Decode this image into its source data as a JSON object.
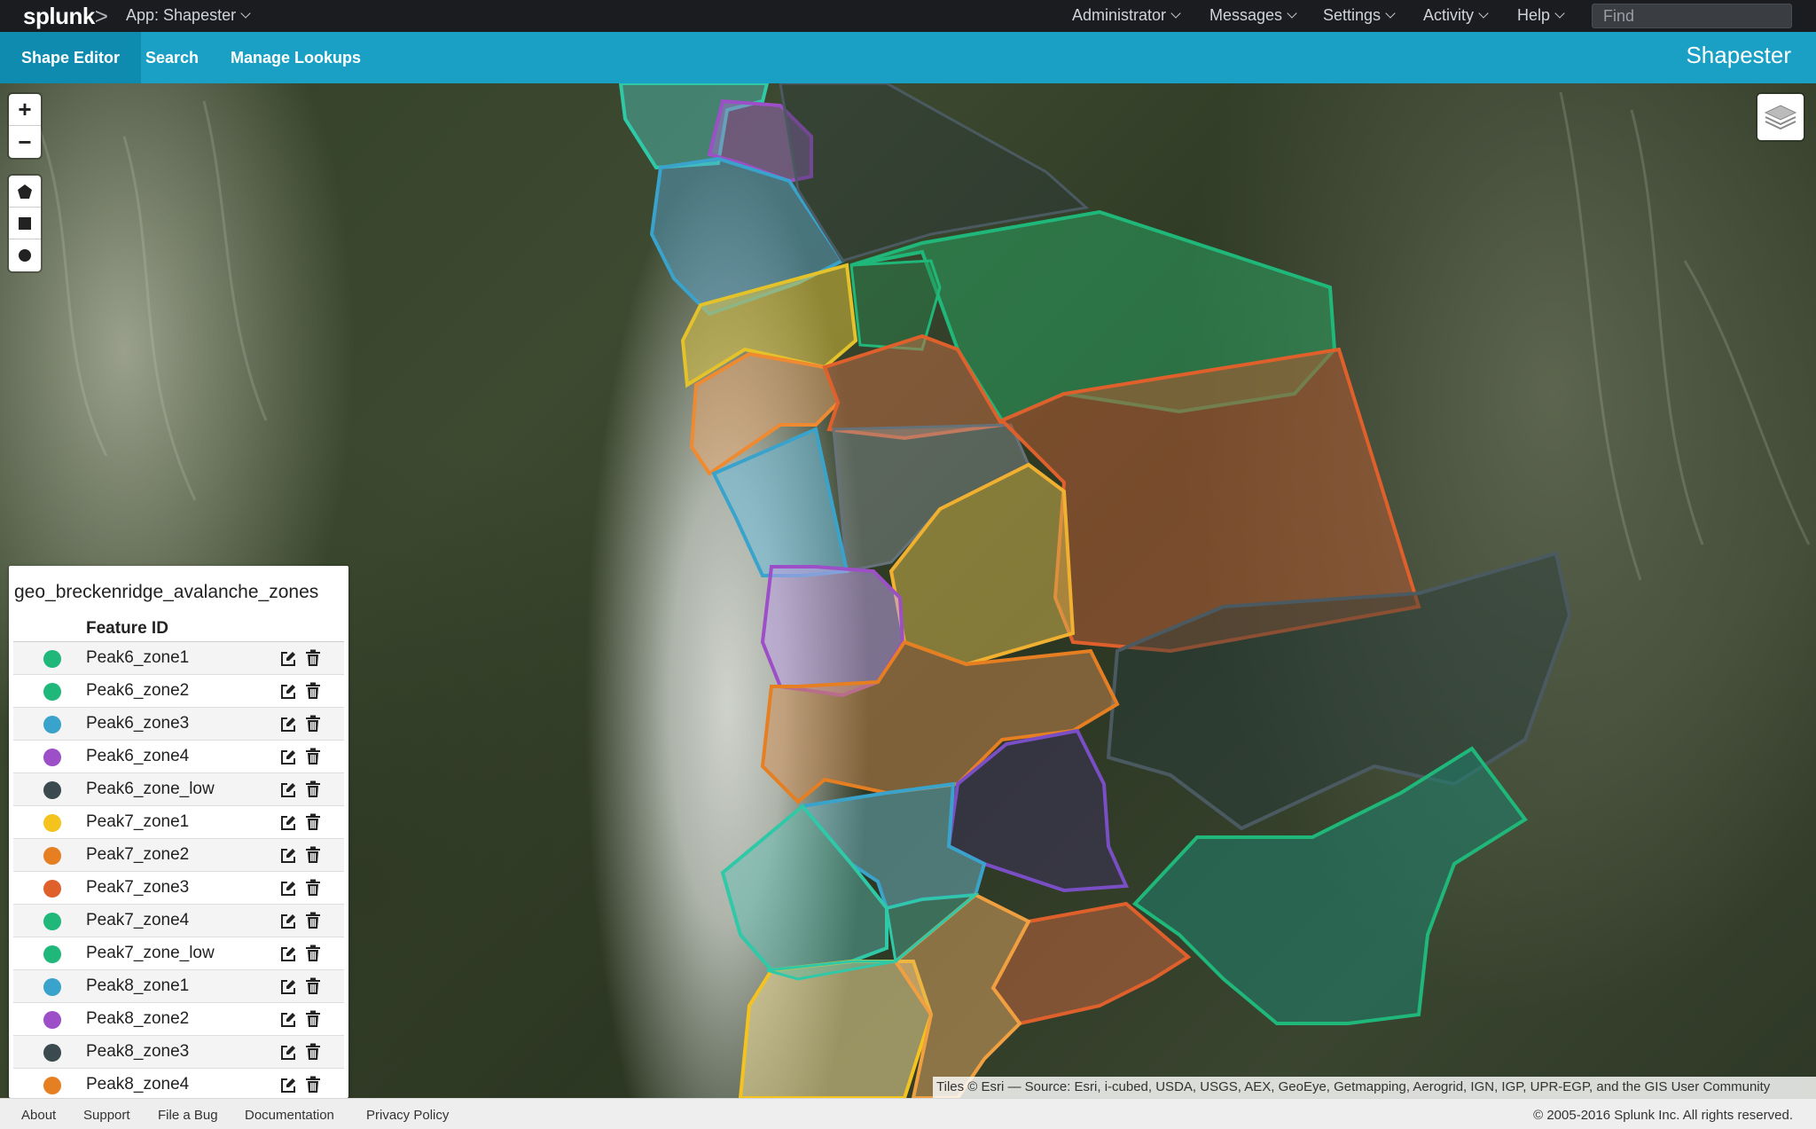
{
  "topbar": {
    "logo": "splunk",
    "logo_suffix": ">",
    "app_menu": "App: Shapester",
    "menus": [
      "Administrator",
      "Messages",
      "Settings",
      "Activity",
      "Help"
    ],
    "find_placeholder": "Find"
  },
  "navbar": {
    "items": [
      "Shape Editor",
      "Search",
      "Manage Lookups"
    ],
    "active": "Shape Editor",
    "brand": "Shapester"
  },
  "map_controls": {
    "zoom_in": "+",
    "zoom_out": "−",
    "draw_tools": [
      "polygon-tool",
      "rectangle-tool",
      "circle-tool"
    ]
  },
  "panel": {
    "title": "geo_breckenridge_avalanche_zones",
    "column_header": "Feature ID",
    "rows": [
      {
        "label": "Peak6_zone1",
        "color": "#1fb87a"
      },
      {
        "label": "Peak6_zone2",
        "color": "#1fb87a"
      },
      {
        "label": "Peak6_zone3",
        "color": "#3aa3cc"
      },
      {
        "label": "Peak6_zone4",
        "color": "#9c4fc6"
      },
      {
        "label": "Peak6_zone_low",
        "color": "#3b4a4f"
      },
      {
        "label": "Peak7_zone1",
        "color": "#f4c31d"
      },
      {
        "label": "Peak7_zone2",
        "color": "#e67e22"
      },
      {
        "label": "Peak7_zone3",
        "color": "#e0602c"
      },
      {
        "label": "Peak7_zone4",
        "color": "#1fb87a"
      },
      {
        "label": "Peak7_zone_low",
        "color": "#1fb87a"
      },
      {
        "label": "Peak8_zone1",
        "color": "#3aa3cc"
      },
      {
        "label": "Peak8_zone2",
        "color": "#9c4fc6"
      },
      {
        "label": "Peak8_zone3",
        "color": "#3b4a4f"
      },
      {
        "label": "Peak8_zone4",
        "color": "#e67e22"
      }
    ]
  },
  "attribution": "Tiles © Esri — Source: Esri, i-cubed, USDA, USGS, AEX, GeoEye, Getmapping, Aerogrid, IGN, IGP, UPR-EGP, and the GIS User Community",
  "footer": {
    "links": [
      "About",
      "Support",
      "File a Bug",
      "Documentation",
      "Privacy Policy"
    ],
    "copyright": "© 2005-2016 Splunk Inc. All rights reserved."
  }
}
